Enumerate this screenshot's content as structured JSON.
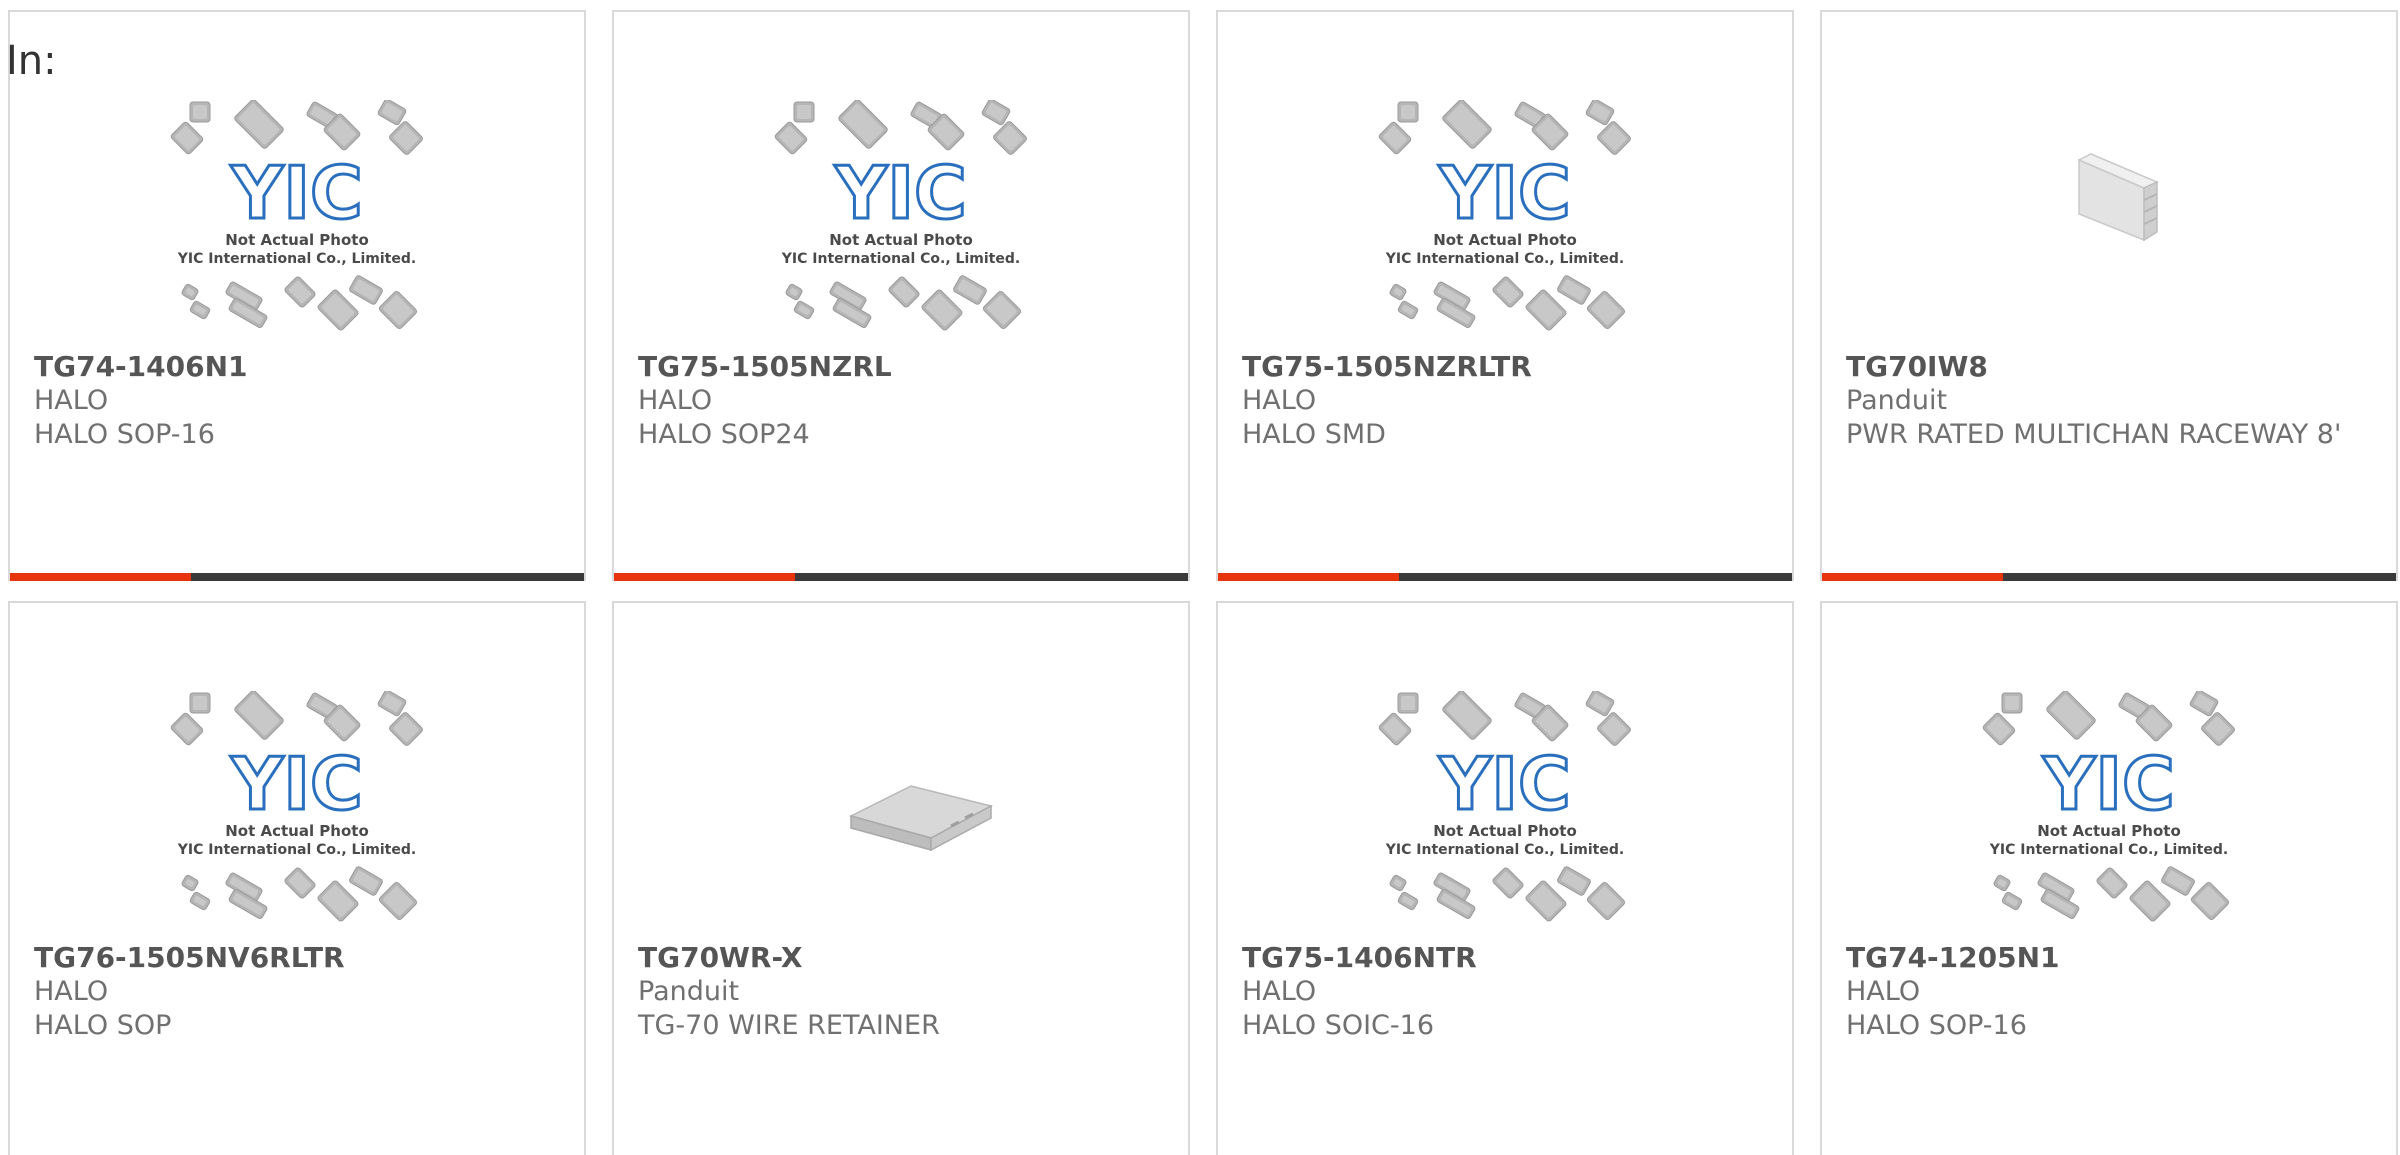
{
  "header": {
    "in_label": "In:"
  },
  "placeholder_text": {
    "line1": "Not Actual Photo",
    "line2": "YIC International Co., Limited.",
    "logo": "YIC"
  },
  "colors": {
    "accent": "#e8340e",
    "bar": "#3a3a3a",
    "logo_blue": "#2a6fbd"
  },
  "products": [
    {
      "part": "TG74-1406N1",
      "manufacturer": "HALO",
      "description": "HALO SOP-16",
      "image": "yic-placeholder",
      "highlight": true
    },
    {
      "part": "TG75-1505NZRL",
      "manufacturer": "HALO",
      "description": "HALO SOP24",
      "image": "yic-placeholder",
      "highlight": true
    },
    {
      "part": "TG75-1505NZRLTR",
      "manufacturer": "HALO",
      "description": "HALO SMD",
      "image": "yic-placeholder",
      "highlight": true
    },
    {
      "part": "TG70IW8",
      "manufacturer": "Panduit",
      "description": "PWR RATED MULTICHAN RACEWAY 8'",
      "image": "raceway",
      "highlight": true
    },
    {
      "part": "TG76-1505NV6RLTR",
      "manufacturer": "HALO",
      "description": "HALO SOP",
      "image": "yic-placeholder",
      "highlight": false
    },
    {
      "part": "TG70WR-X",
      "manufacturer": "Panduit",
      "description": "TG-70 WIRE RETAINER",
      "image": "wire-retainer",
      "highlight": false
    },
    {
      "part": "TG75-1406NTR",
      "manufacturer": "HALO",
      "description": "HALO SOIC-16",
      "image": "yic-placeholder",
      "highlight": false
    },
    {
      "part": "TG74-1205N1",
      "manufacturer": "HALO",
      "description": "HALO SOP-16",
      "image": "yic-placeholder",
      "highlight": false
    }
  ]
}
